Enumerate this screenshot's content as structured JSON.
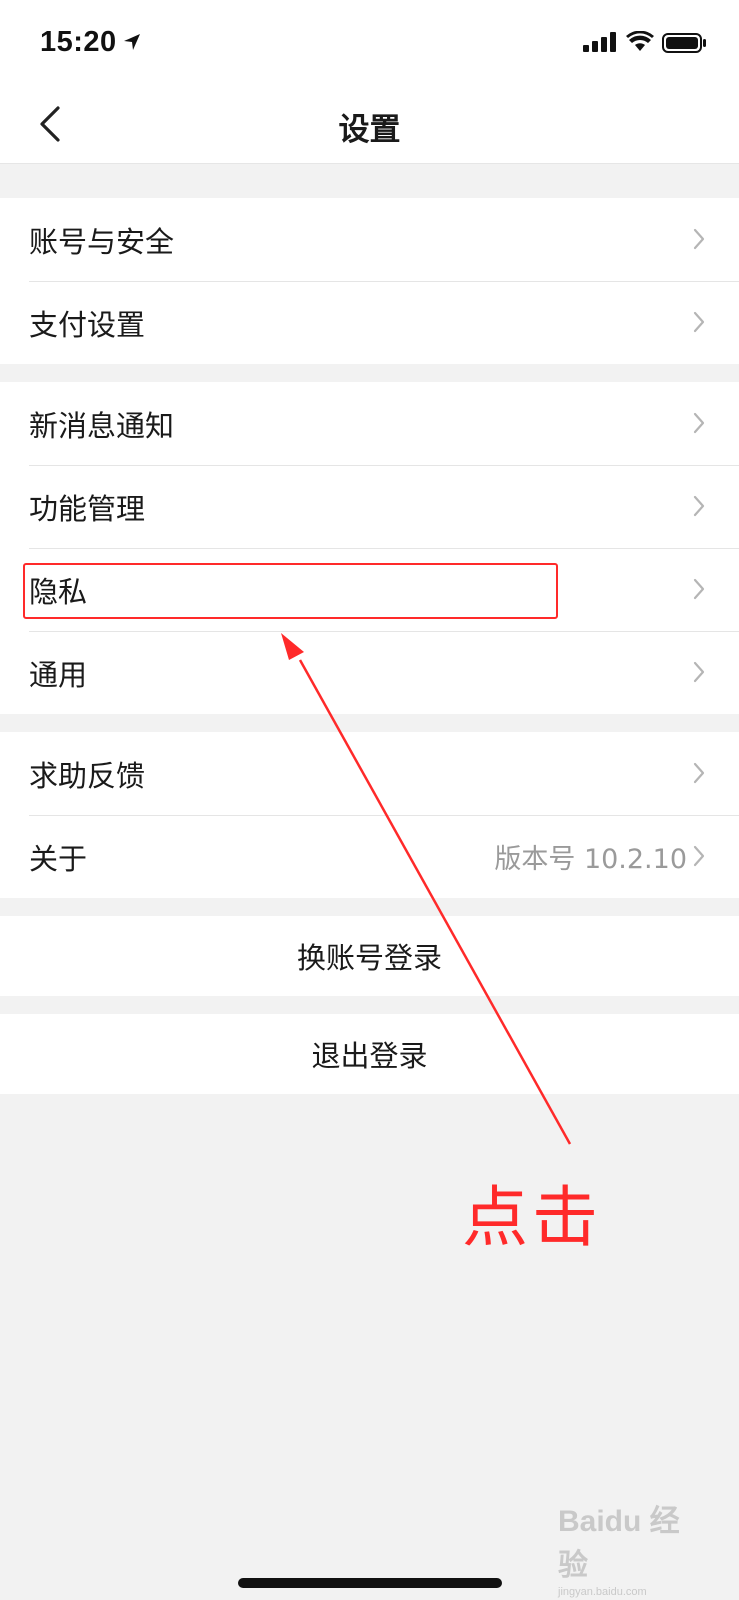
{
  "status_bar": {
    "time": "15:20",
    "icons": [
      "location-arrow-icon",
      "signal-icon",
      "wifi-icon",
      "battery-icon"
    ]
  },
  "nav": {
    "back_icon": "chevron-left-icon",
    "title": "设置"
  },
  "groups": [
    {
      "items": [
        {
          "label": "账号与安全"
        },
        {
          "label": "支付设置"
        }
      ]
    },
    {
      "items": [
        {
          "label": "新消息通知"
        },
        {
          "label": "功能管理"
        },
        {
          "label": "隐私"
        },
        {
          "label": "通用"
        }
      ]
    },
    {
      "items": [
        {
          "label": "求助反馈"
        },
        {
          "label": "关于",
          "value": "版本号 10.2.10"
        }
      ]
    }
  ],
  "actions": {
    "switch_account": "换账号登录",
    "logout": "退出登录"
  },
  "annotation": {
    "text": "点击",
    "color": "#ff2a2a",
    "target": "隐私"
  },
  "watermark": {
    "text": "Baidu 经验",
    "subtext": "jingyan.baidu.com"
  },
  "colors": {
    "background": "#f2f2f2",
    "surface": "#ffffff",
    "divider": "#e5e5e5",
    "secondary_text": "#9a9a9a"
  }
}
